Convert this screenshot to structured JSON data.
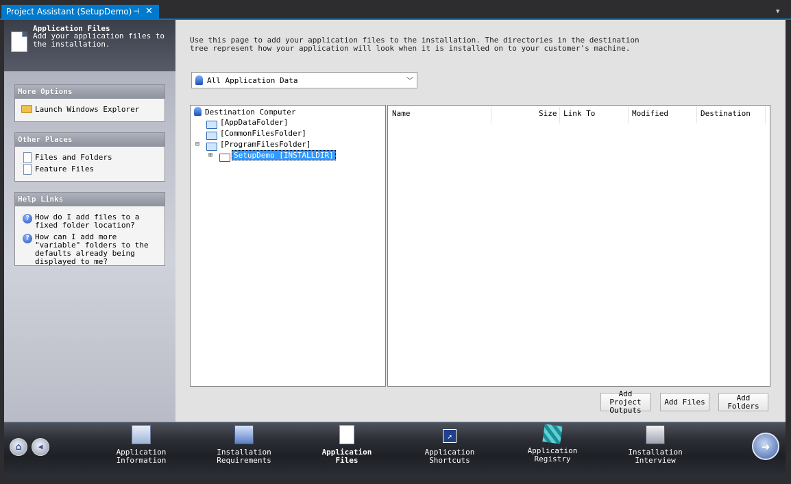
{
  "tab": {
    "title": "Project Assistant (SetupDemo)",
    "pin": "⊣",
    "close": "✕"
  },
  "header": {
    "title": "Application Files",
    "description": "Add your application files to the installation."
  },
  "more_options": {
    "title": "More Options",
    "items": [
      "Launch Windows Explorer"
    ]
  },
  "other_places": {
    "title": "Other Places",
    "items": [
      "Files and Folders",
      "Feature Files"
    ]
  },
  "help_links": {
    "title": "Help Links",
    "items": [
      "How do I add files to a fixed folder location?",
      "How can I add more \"variable\" folders to the defaults already being displayed to me?"
    ]
  },
  "instructions": "Use this page to add your application files to the installation. The directories in the destination tree represent how your application will look when it is installed on to your customer's machine.",
  "data_dropdown": {
    "value": "All Application Data"
  },
  "tree": {
    "root": "Destination Computer",
    "folders": [
      "[AppDataFolder]",
      "[CommonFilesFolder]",
      "[ProgramFilesFolder]"
    ],
    "child": "SetupDemo [INSTALLDIR]",
    "expand": "⊞",
    "collapse": "⊟"
  },
  "file_list": {
    "columns": [
      "Name",
      "Size",
      "Link To",
      "Modified",
      "Destination"
    ]
  },
  "buttons": {
    "add_project_outputs": "Add Project Outputs",
    "add_files": "Add Files",
    "add_folders": "Add Folders"
  },
  "nav": {
    "home": "⌂",
    "back": "◀",
    "next": "➜",
    "steps": [
      {
        "label": "Application Information",
        "icon": "app-info-icon"
      },
      {
        "label": "Installation Requirements",
        "icon": "requirements-icon"
      },
      {
        "label": "Application Files",
        "icon": "files-icon"
      },
      {
        "label": "Application Shortcuts",
        "icon": "shortcut-icon"
      },
      {
        "label": "Application Registry",
        "icon": "registry-icon"
      },
      {
        "label": "Installation Interview",
        "icon": "interview-icon"
      }
    ]
  },
  "colors": {
    "accent": "#007acc",
    "selection": "#3399ff",
    "frame": "#e2e2e2"
  }
}
